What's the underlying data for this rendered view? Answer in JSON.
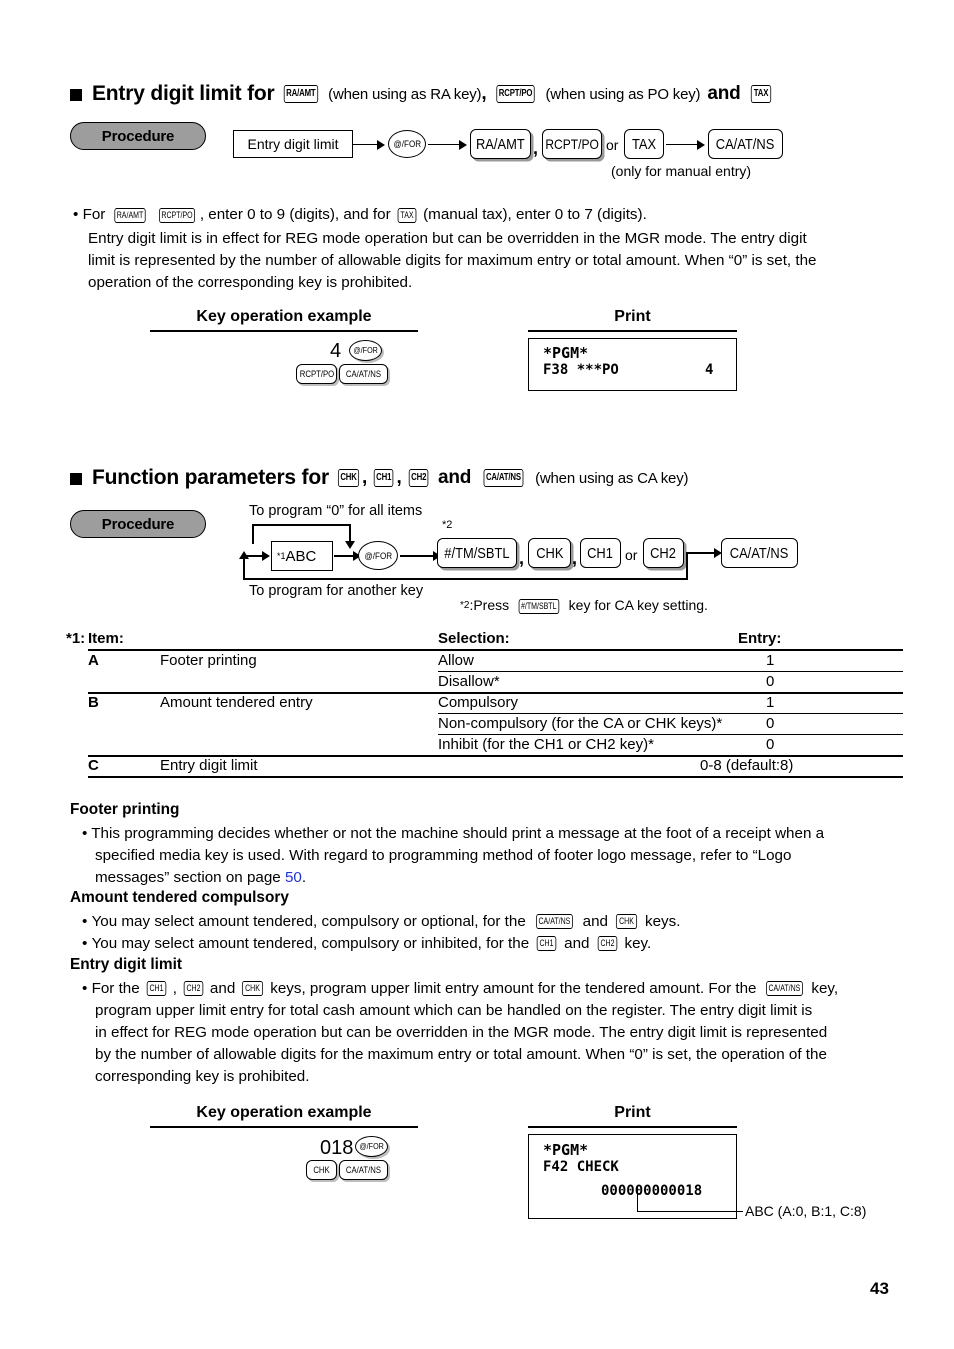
{
  "section1": {
    "heading": {
      "title_a": "Entry digit limit for",
      "key1": "RA/AMT",
      "note1": "(when using as RA key)",
      "comma": ",",
      "key2": "RCPT/PO",
      "note2": "(when using as PO key)",
      "and": "and",
      "key3": "TAX"
    },
    "procedure": {
      "pill_label": "Procedure",
      "input_box": "Entry digit limit",
      "for_key": "@/FOR",
      "key_ra": "RA/AMT",
      "sep_comma": ",",
      "key_rcpt": "RCPT/PO",
      "or": "or",
      "key_tax": "TAX",
      "key_ca": "CA/AT/NS",
      "footnote": "(only for manual entry)"
    },
    "body": {
      "bullet": "•",
      "line1_a": "For",
      "line1_k1": "RA/AMT",
      "line1_k2": "RCPT/PO",
      "line1_b": ", enter 0 to 9 (digits), and for",
      "line1_k3": "TAX",
      "line1_c": "(manual tax), enter 0 to 7 (digits).",
      "line2": "Entry digit limit is in effect for REG mode operation but can be overridden in the MGR mode.  The entry digit",
      "line3": "limit is represented by the number of allowable digits for maximum entry or total amount.  When “0” is set, the",
      "line4": "operation of the corresponding key is prohibited."
    },
    "example": {
      "caption": "Key operation example",
      "entry_number": "4",
      "key_for": "@/FOR",
      "key_rcpt": "RCPT/PO",
      "key_ca": "CA/AT/NS"
    },
    "print": {
      "caption": "Print",
      "line1": "*PGM*",
      "line2_left": "F38 ***PO",
      "line2_right": "4"
    }
  },
  "section2": {
    "heading": {
      "title_a": "Function parameters for",
      "key1": "CHK",
      "key2": "CH1",
      "key3": "CH2",
      "and": "and",
      "key4": "CA/AT/NS",
      "note": "(when using as CA key)"
    },
    "procedure": {
      "pill_label": "Procedure",
      "top_label": "To program  “0” for all items",
      "bottom_label": "To program for another key",
      "abc_star": "*1",
      "abc": "ABC",
      "for_key": "@/FOR",
      "star2_mark": "*2",
      "key_tmsbtl": "#/TM/SBTL",
      "key_chk": "CHK",
      "key_ch1": "CH1",
      "or": "or",
      "key_ch2": "CH2",
      "key_ca": "CA/AT/NS",
      "footnote_pre": "*2",
      "footnote_a": ":Press",
      "footnote_key": "#/TM/SBTL",
      "footnote_b": "key for CA key setting."
    },
    "table": {
      "star": "*1:",
      "col_item": "Item:",
      "col_selection": "Selection:",
      "col_entry": "Entry:",
      "rows": [
        {
          "letter": "A",
          "item": "Footer printing",
          "selection": "Allow",
          "entry": "1"
        },
        {
          "letter": "",
          "item": "",
          "selection": "Disallow*",
          "entry": "0"
        },
        {
          "letter": "B",
          "item": "Amount tendered entry",
          "selection": "Compulsory",
          "entry": "1"
        },
        {
          "letter": "",
          "item": "",
          "selection": "Non-compulsory (for the CA or CHK keys)*",
          "entry": "0"
        },
        {
          "letter": "",
          "item": "",
          "selection": "Inhibit (for the CH1 or CH2 key)*",
          "entry": "0"
        },
        {
          "letter": "C",
          "item": "Entry digit limit",
          "selection": "",
          "entry": "0-8 (default:8)"
        }
      ]
    },
    "notes": {
      "h1": "Footer printing",
      "p1_l1": "This programming decides whether or not the machine should print a message at the foot of a receipt when a",
      "p1_l2": "specified media key is used.  With regard to programming method of footer logo message, refer to “Logo",
      "p1_l3_a": "messages” section on page",
      "p1_l3_link": "50",
      "p1_l3_b": ".",
      "h2": "Amount tendered compulsory",
      "p2_a": "You may select amount tendered, compulsory or optional, for the",
      "p2_k1": "CA/AT/NS",
      "p2_b": "and",
      "p2_k2": "CHK",
      "p2_c": "keys.",
      "p3_a": "You may select amount tendered, compulsory or inhibited, for the",
      "p3_k1": "CH1",
      "p3_b": "and",
      "p3_k2": "CH2",
      "p3_c": "key.",
      "h3": "Entry digit limit",
      "p4_a": "For the",
      "p4_k1": "CH1",
      "p4_comma": ",",
      "p4_k2": "CH2",
      "p4_b": "and",
      "p4_k3": "CHK",
      "p4_c": "keys, program upper limit entry amount for the tendered amount.  For the",
      "p4_k4": "CA/AT/NS",
      "p4_d": "key,",
      "p4_l2": "program upper limit entry for total cash amount which can be handled on the register.  The entry digit limit is",
      "p4_l3": "in effect for REG mode operation but can be overridden in the MGR mode.  The entry digit limit is represented",
      "p4_l4": "by the number of allowable digits for the maximum entry or total amount.  When “0” is set, the operation of the",
      "p4_l5": "corresponding key is prohibited."
    },
    "example": {
      "caption": "Key operation example",
      "entry_number": "018",
      "key_for": "@/FOR",
      "key_chk": "CHK",
      "key_ca": "CA/AT/NS"
    },
    "print": {
      "caption": "Print",
      "line1": "*PGM*",
      "line2": "F42 CHECK",
      "line3": "000000000018",
      "callout": "ABC (A:0, B:1, C:8)"
    }
  },
  "footer": {
    "page_number": "43"
  },
  "colors": {
    "pill_fill": "#9d9d9d",
    "link": "#2233cc",
    "ink": "#000000"
  }
}
